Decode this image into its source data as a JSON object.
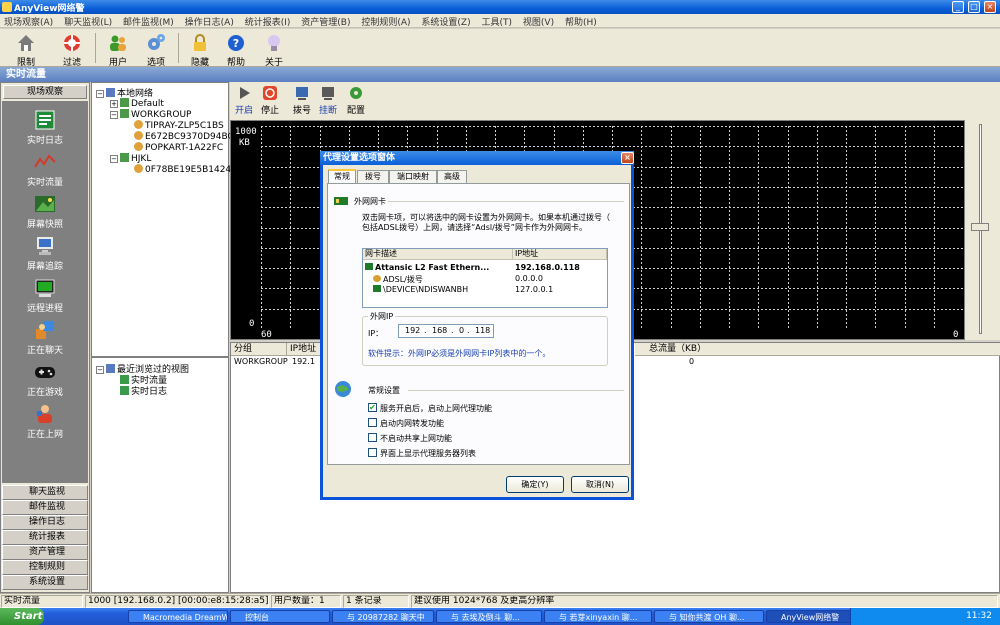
{
  "window": {
    "title": "AnyView网络警",
    "controls": [
      "_",
      "□",
      "×"
    ]
  },
  "menu": [
    "现场观察(A)",
    "聊天监视(L)",
    "邮件监视(M)",
    "操作日志(A)",
    "统计报表(I)",
    "资产管理(B)",
    "控制规则(A)",
    "系统设置(Z)",
    "工具(T)",
    "视图(V)",
    "帮助(H)"
  ],
  "toolbar": {
    "items": [
      {
        "label": "限制",
        "icon": "house-icon"
      },
      {
        "label": "过滤",
        "icon": "lifebuoy-icon"
      },
      {
        "label": "用户",
        "icon": "users-icon"
      },
      {
        "label": "选项",
        "icon": "gears-icon"
      },
      {
        "label": "隐藏",
        "icon": "lock-icon"
      },
      {
        "label": "帮助",
        "icon": "help-icon"
      },
      {
        "label": "关于",
        "icon": "bulb-icon"
      }
    ]
  },
  "section_title": "实时流量",
  "left_nav": {
    "header": "现场观察",
    "icons": [
      {
        "label": "实时日志",
        "icon": "log-icon"
      },
      {
        "label": "实时流量",
        "icon": "traffic-icon"
      },
      {
        "label": "屏幕快照",
        "icon": "screenshot-icon"
      },
      {
        "label": "屏幕追踪",
        "icon": "screen-track-icon"
      },
      {
        "label": "远程进程",
        "icon": "process-icon"
      },
      {
        "label": "正在聊天",
        "icon": "chat-icon"
      },
      {
        "label": "正在游戏",
        "icon": "gamepad-icon"
      },
      {
        "label": "正在上网",
        "icon": "browsing-icon"
      }
    ],
    "sections": [
      "聊天监视",
      "邮件监视",
      "操作日志",
      "统计报表",
      "资产管理",
      "控制规则",
      "系统设置"
    ]
  },
  "tree": {
    "root": "本地网络",
    "groups": [
      {
        "name": "Default",
        "children": []
      },
      {
        "name": "WORKGROUP",
        "children": [
          "TIPRAY-ZLP5C1BS",
          "E672BC9370D94BC",
          "POPKART-1A22FC"
        ]
      },
      {
        "name": "HJKL",
        "children": [
          "0F78BE19E5B1424"
        ]
      }
    ]
  },
  "recent_views": {
    "title": "最近浏览过的视图",
    "items": [
      "实时流量",
      "实时日志"
    ]
  },
  "content_toolbar": [
    {
      "label": "开启",
      "icon": "play-icon"
    },
    {
      "label": "停止",
      "icon": "stop-icon"
    },
    {
      "label": "拨号",
      "icon": "dial-icon"
    },
    {
      "label": "挂断",
      "icon": "hangup-icon"
    },
    {
      "label": "配置",
      "icon": "config-icon"
    }
  ],
  "chart": {
    "ymax": "1000",
    "unit": "KB",
    "ymin": "0",
    "xstart": "60",
    "xend": "0"
  },
  "table": {
    "columns": [
      "分组",
      "IP地址",
      "总流量（KB）"
    ],
    "rows": [
      {
        "group": "WORKGROUP",
        "ip": "192.1",
        "total": "0"
      }
    ]
  },
  "dialog": {
    "title": "代理设置选项窗体",
    "close": "×",
    "tabs": [
      "常规",
      "拨号",
      "端口映射",
      "高级"
    ],
    "nic_section": "外网网卡",
    "nic_desc_line1": "双击网卡项，可以将选中的网卡设置为外网网卡。如果本机通过拨号（",
    "nic_desc_line2": "包括ADSL拨号）上网，请选择“Adsl/拨号”网卡作为外网网卡。",
    "nic_columns": [
      "网卡描述",
      "IP地址"
    ],
    "nics": [
      {
        "name": "Attansic L2 Fast Ethern...",
        "ip": "192.168.0.118"
      },
      {
        "name": "ADSL/拨号",
        "ip": "0.0.0.0"
      },
      {
        "name": "\\DEVICE\\NDISWANBH",
        "ip": "127.0.0.1"
      }
    ],
    "ext_ip_group": "外网IP",
    "ip_label": "IP：",
    "ip_parts": [
      "192",
      "168",
      "0",
      "118"
    ],
    "hint": "软件提示：外网IP必须是外网网卡IP列表中的一个。",
    "general_section": "常规设置",
    "options": [
      {
        "label": "服务开启后，启动上网代理功能",
        "checked": true
      },
      {
        "label": "启动内网转发功能",
        "checked": false
      },
      {
        "label": "不启动共享上网功能",
        "checked": false
      },
      {
        "label": "界面上显示代理服务器列表",
        "checked": false
      }
    ],
    "ok": "确定(Y)",
    "cancel": "取消(N)"
  },
  "statusbar": {
    "mode": "实时流量",
    "device": "1000 [192.168.0.2] [00:00:e8:15:28:a5]",
    "users": "用户数量：1",
    "records": "1 条记录",
    "advice": "建议使用 1024*768 及更高分辨率"
  },
  "taskbar": {
    "start": "Start",
    "tasks": [
      "Macromedia DreamW...",
      "控制台",
      "与 20987282 聊天中",
      "与 去埃及倒斗 聊...",
      "与 若芽xinyaxin 聊...",
      "与 知你共渡 OH 聊...",
      "AnyView网络警"
    ],
    "clock": "11:32"
  }
}
